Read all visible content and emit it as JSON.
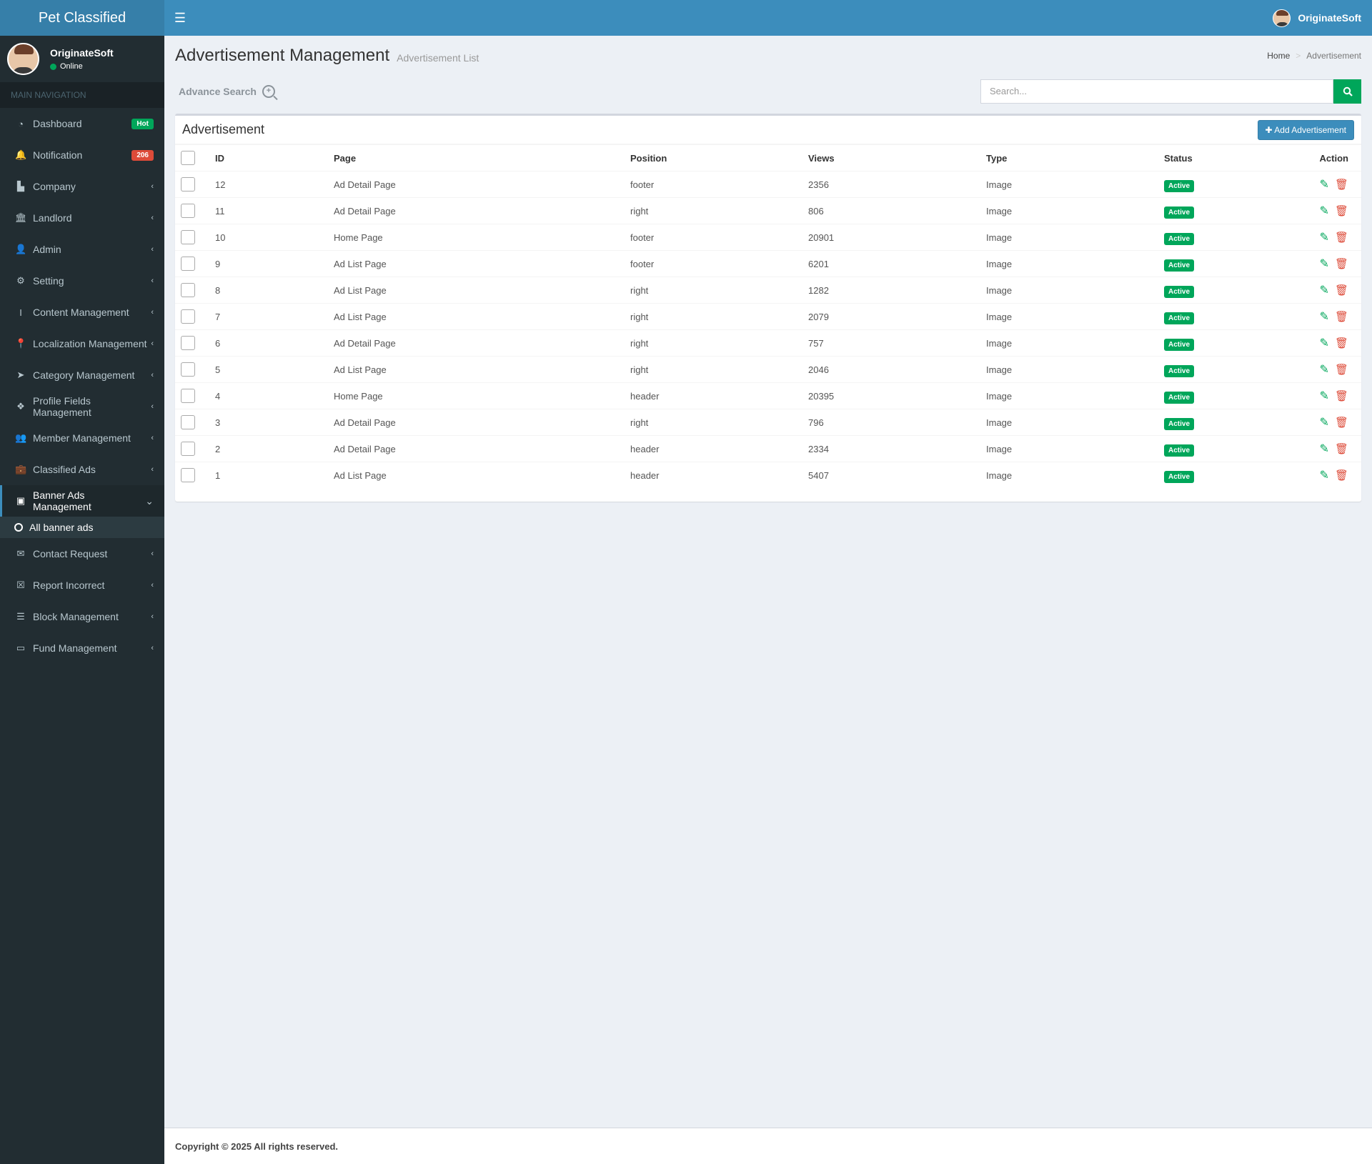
{
  "brand": "Pet Classified",
  "topbar": {
    "menu_icon": "hamburger-icon",
    "user_name": "OriginateSoft"
  },
  "sidebar": {
    "user_name": "OriginateSoft",
    "user_status": "Online",
    "nav_header": "MAIN NAVIGATION",
    "items": [
      {
        "label": "Dashboard",
        "icon": "dashboard-icon",
        "glyph": "◔",
        "badge": "Hot",
        "badge_color": "green"
      },
      {
        "label": "Notification",
        "icon": "bell-icon",
        "glyph": "🔔",
        "badge": "206",
        "badge_color": "red"
      },
      {
        "label": "Company",
        "icon": "chart-icon",
        "glyph": "▙",
        "chevron": true
      },
      {
        "label": "Landlord",
        "icon": "bank-icon",
        "glyph": "🏛",
        "chevron": true
      },
      {
        "label": "Admin",
        "icon": "user-icon",
        "glyph": "👤",
        "chevron": true
      },
      {
        "label": "Setting",
        "icon": "gear-icon",
        "glyph": "⚙",
        "chevron": true
      },
      {
        "label": "Content Management",
        "icon": "cursor-icon",
        "glyph": "I",
        "chevron": true
      },
      {
        "label": "Localization Management",
        "icon": "map-marker-icon",
        "glyph": "📍",
        "chevron": true
      },
      {
        "label": "Category Management",
        "icon": "pointer-icon",
        "glyph": "➤",
        "chevron": true
      },
      {
        "label": "Profile Fields Management",
        "icon": "cubes-icon",
        "glyph": "❖",
        "chevron": true
      },
      {
        "label": "Member Management",
        "icon": "users-icon",
        "glyph": "👥",
        "chevron": true
      },
      {
        "label": "Classified Ads",
        "icon": "briefcase-icon",
        "glyph": "💼",
        "chevron": true
      },
      {
        "label": "Banner Ads Management",
        "icon": "archive-icon",
        "glyph": "▣",
        "chevron": true,
        "active": true
      },
      {
        "label": "Contact Request",
        "icon": "envelope-icon",
        "glyph": "✉",
        "chevron": true
      },
      {
        "label": "Report Incorrect",
        "icon": "file-x-icon",
        "glyph": "☒",
        "chevron": true
      },
      {
        "label": "Block Management",
        "icon": "list-icon",
        "glyph": "☰",
        "chevron": true
      },
      {
        "label": "Fund Management",
        "icon": "money-icon",
        "glyph": "▭",
        "chevron": true
      }
    ],
    "subitem": "All banner ads"
  },
  "header": {
    "title": "Advertisement Management",
    "subtitle": "Advertisement List",
    "breadcrumb": [
      "Home",
      "Advertisement"
    ]
  },
  "search": {
    "advance_label": "Advance Search",
    "placeholder": "Search..."
  },
  "box": {
    "title": "Advertisement",
    "add_button": "Add Advertisement",
    "columns": [
      "ID",
      "Page",
      "Position",
      "Views",
      "Type",
      "Status",
      "Action"
    ],
    "rows": [
      {
        "id": "12",
        "page": "Ad Detail Page",
        "position": "footer",
        "views": "2356",
        "type": "Image",
        "status": "Active"
      },
      {
        "id": "11",
        "page": "Ad Detail Page",
        "position": "right",
        "views": "806",
        "type": "Image",
        "status": "Active"
      },
      {
        "id": "10",
        "page": "Home Page",
        "position": "footer",
        "views": "20901",
        "type": "Image",
        "status": "Active"
      },
      {
        "id": "9",
        "page": "Ad List Page",
        "position": "footer",
        "views": "6201",
        "type": "Image",
        "status": "Active"
      },
      {
        "id": "8",
        "page": "Ad List Page",
        "position": "right",
        "views": "1282",
        "type": "Image",
        "status": "Active"
      },
      {
        "id": "7",
        "page": "Ad List Page",
        "position": "right",
        "views": "2079",
        "type": "Image",
        "status": "Active"
      },
      {
        "id": "6",
        "page": "Ad Detail Page",
        "position": "right",
        "views": "757",
        "type": "Image",
        "status": "Active"
      },
      {
        "id": "5",
        "page": "Ad List Page",
        "position": "right",
        "views": "2046",
        "type": "Image",
        "status": "Active"
      },
      {
        "id": "4",
        "page": "Home Page",
        "position": "header",
        "views": "20395",
        "type": "Image",
        "status": "Active"
      },
      {
        "id": "3",
        "page": "Ad Detail Page",
        "position": "right",
        "views": "796",
        "type": "Image",
        "status": "Active"
      },
      {
        "id": "2",
        "page": "Ad Detail Page",
        "position": "header",
        "views": "2334",
        "type": "Image",
        "status": "Active"
      },
      {
        "id": "1",
        "page": "Ad List Page",
        "position": "header",
        "views": "5407",
        "type": "Image",
        "status": "Active"
      }
    ]
  },
  "footer": "Copyright © 2025 All rights reserved.",
  "colors": {
    "primary": "#3c8dbc",
    "success": "#00a65a",
    "danger": "#dd4b39",
    "sidebar": "#222d32"
  }
}
